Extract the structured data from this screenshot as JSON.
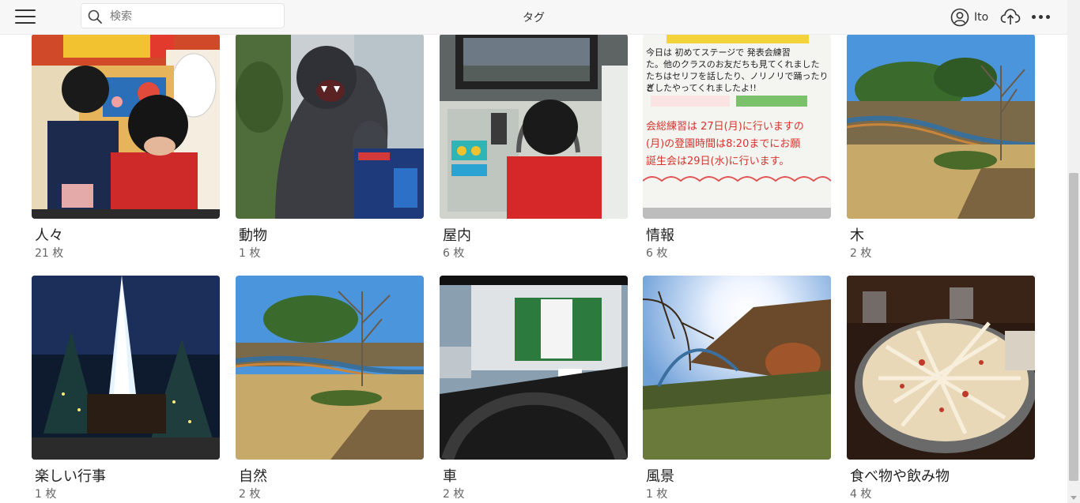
{
  "header": {
    "menu_icon": "hamburger-icon",
    "search": {
      "placeholder": "検索",
      "value": "",
      "icon": "search-icon"
    },
    "title": "タグ",
    "user_name": "Ito",
    "user_icon": "account-circle-icon",
    "upload_icon": "cloud-upload-icon",
    "more_icon": "more-horizontal-icon"
  },
  "tags": [
    {
      "name": "人々",
      "count": "21 枚"
    },
    {
      "name": "動物",
      "count": "1 枚"
    },
    {
      "name": "屋内",
      "count": "6 枚"
    },
    {
      "name": "情報",
      "count": "6 枚"
    },
    {
      "name": "木",
      "count": "2 枚"
    },
    {
      "name": "楽しい行事",
      "count": "1 枚"
    },
    {
      "name": "自然",
      "count": "2 枚"
    },
    {
      "name": "車",
      "count": "2 枚"
    },
    {
      "name": "風景",
      "count": "1 枚"
    },
    {
      "name": "食べ物や飲み物",
      "count": "4 枚"
    }
  ],
  "whiteboard_text": [
    "今日は 初めてステージで 発表会練習",
    "た。他のクラスのお友だちも見てくれました",
    "たちはセリフを話したり、ノリノリで踊ったりと",
    "ぎしたやってくれましたよ!!",
    "会総練習は 27日(月)に行いますの",
    "(月)の登園時間は8:20までにお願",
    "誕生会は29日(水)に行います。"
  ],
  "colors": {
    "accent": "#333333",
    "muted": "#666666",
    "header_bg": "#f7f7f7"
  }
}
